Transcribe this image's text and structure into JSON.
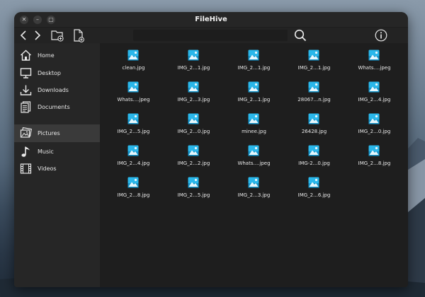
{
  "window": {
    "title": "FileHive",
    "controls": [
      "close",
      "minimize",
      "maximize"
    ]
  },
  "toolbar": {
    "path": "",
    "buttons": [
      "back",
      "forward",
      "new-folder",
      "new-file",
      "search",
      "info"
    ]
  },
  "sidebar": {
    "items": [
      {
        "label": "Home",
        "icon": "home-icon",
        "active": false
      },
      {
        "label": "Desktop",
        "icon": "desktop-icon",
        "active": false
      },
      {
        "label": "Downloads",
        "icon": "download-icon",
        "active": false
      },
      {
        "label": "Documents",
        "icon": "documents-icon",
        "active": false
      },
      {
        "label": "Pictures",
        "icon": "pictures-icon",
        "active": true
      },
      {
        "label": "Music",
        "icon": "music-icon",
        "active": false
      },
      {
        "label": "Videos",
        "icon": "video-icon",
        "active": false
      }
    ]
  },
  "files": [
    {
      "name": "clean.jpg"
    },
    {
      "name": "IMG_2...1.jpg"
    },
    {
      "name": "IMG_2...1.jpg"
    },
    {
      "name": "IMG_2...1.jpg"
    },
    {
      "name": "Whats....jpeg"
    },
    {
      "name": "Whats....jpeg"
    },
    {
      "name": "IMG_2...3.jpg"
    },
    {
      "name": "IMG_2...1.jpg"
    },
    {
      "name": "28067...n.jpg"
    },
    {
      "name": "IMG_2...4.jpg"
    },
    {
      "name": "IMG_2...5.jpg"
    },
    {
      "name": "IMG_2...0.jpg"
    },
    {
      "name": "minee.jpg"
    },
    {
      "name": "26428.jpg"
    },
    {
      "name": "IMG_2...0.jpg"
    },
    {
      "name": "IMG_2...4.jpg"
    },
    {
      "name": "IMG_2...2.jpg"
    },
    {
      "name": "Whats....jpeg"
    },
    {
      "name": "IMG-2...0.jpg"
    },
    {
      "name": "IMG_2...8.jpg"
    },
    {
      "name": "IMG_2...8.jpg"
    },
    {
      "name": "IMG_2...5.jpg"
    },
    {
      "name": "IMG_2...3.jpg"
    },
    {
      "name": "IMG_2...6.jpg"
    }
  ],
  "colors": {
    "window_bg": "#2b2b2b",
    "content_bg": "#1e1e1e",
    "sidebar_bg": "#262626",
    "active_item": "#3a3a3a",
    "image_icon": "#29b6e8"
  }
}
